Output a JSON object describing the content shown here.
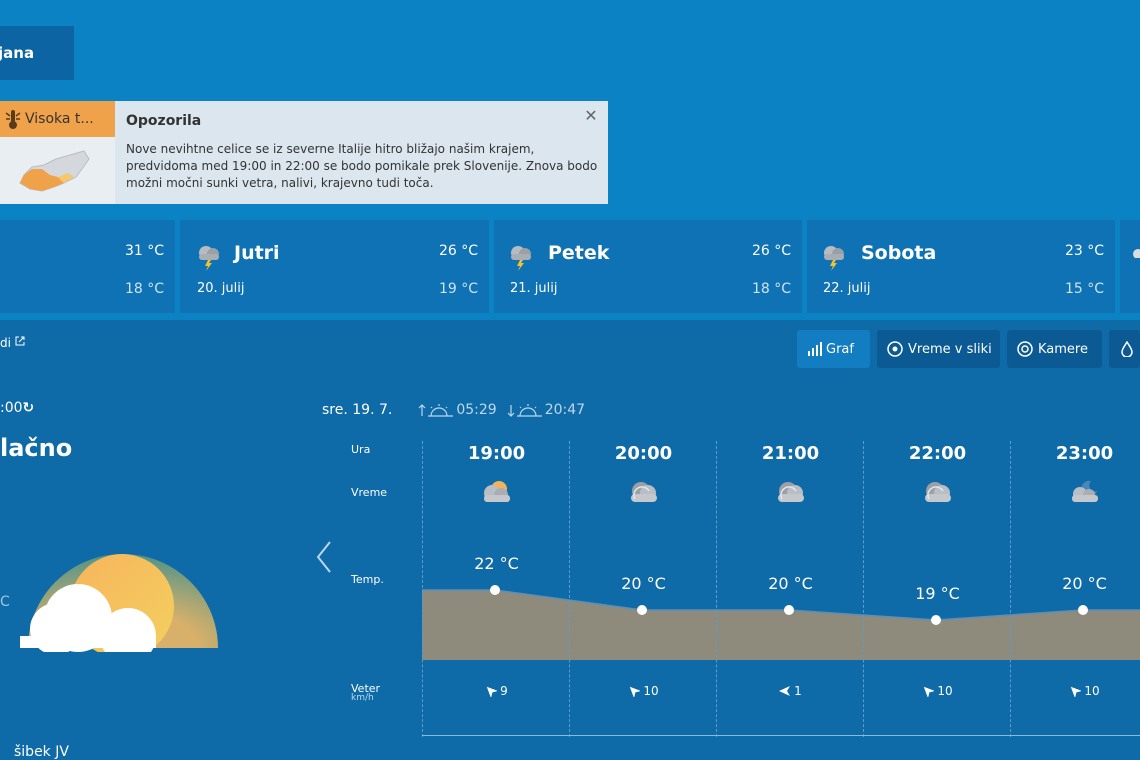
{
  "location": {
    "label": "jana"
  },
  "warning": {
    "tag": "Visoka t...",
    "title": "Opozorila",
    "text": "Nove nevihtne celice se iz severne Italije hitro bližajo našim krajem, predvidoma med 19:00 in 22:00 se bodo pomikale prek Slovenije. Znova bodo možni močni sunki vetra, nalivi, krajevno tudi toča.",
    "close_icon": "close-icon"
  },
  "days": [
    {
      "name": "",
      "date": "",
      "tmax": "31 °C",
      "tmin": "18 °C"
    },
    {
      "name": "Jutri",
      "date": "20. julij",
      "tmax": "26 °C",
      "tmin": "19 °C",
      "icon": "thunderstorm-icon"
    },
    {
      "name": "Petek",
      "date": "21. julij",
      "tmax": "26 °C",
      "tmin": "18 °C",
      "icon": "thunderstorm-icon"
    },
    {
      "name": "Sobota",
      "date": "22. julij",
      "tmax": "23 °C",
      "tmin": "15 °C",
      "icon": "thunderstorm-icon"
    }
  ],
  "link_fragment": "di",
  "toolbar": {
    "graf": "Graf",
    "vreme_v_sliki": "Vreme v sliki",
    "kamere": "Kamere"
  },
  "current": {
    "time_fragment": ":00",
    "desc_fragment": "lačno",
    "temp_fragment": "C",
    "wind_fragment": "šibek JV"
  },
  "forecast": {
    "date": "sre. 19. 7.",
    "sunrise": "05:29",
    "sunset": "20:47",
    "labels": {
      "hour": "Ura",
      "weather": "Vreme",
      "temp": "Temp.",
      "wind": "Veter",
      "wind_unit": "km/h"
    },
    "hours": [
      {
        "hour": "19:00",
        "temp": "22 °C",
        "temp_value": 22,
        "wind": "9",
        "wind_dir": "NW",
        "icon": "partly-cloudy-icon"
      },
      {
        "hour": "20:00",
        "temp": "20 °C",
        "temp_value": 20,
        "wind": "10",
        "wind_dir": "NW",
        "icon": "cloudy-icon"
      },
      {
        "hour": "21:00",
        "temp": "20 °C",
        "temp_value": 20,
        "wind": "1",
        "wind_dir": "W",
        "icon": "cloudy-icon"
      },
      {
        "hour": "22:00",
        "temp": "19 °C",
        "temp_value": 19,
        "wind": "10",
        "wind_dir": "NW",
        "icon": "cloudy-icon"
      },
      {
        "hour": "23:00",
        "temp": "20 °C",
        "temp_value": 20,
        "wind": "10",
        "wind_dir": "NW",
        "icon": "partly-cloudy-night-icon"
      }
    ]
  },
  "colors": {
    "background": "#0f6aa8",
    "top_band": "#0a82c4",
    "warning_orange": "#f0a24a",
    "chart_fill": "#8e8a7c"
  }
}
